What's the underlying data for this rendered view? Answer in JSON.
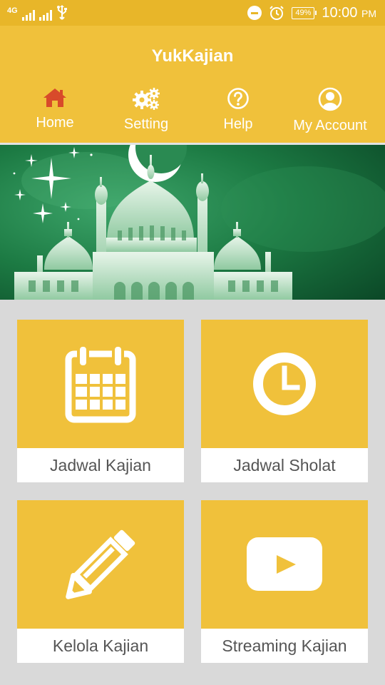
{
  "status_bar": {
    "network": "4G",
    "battery": "49%",
    "time": "10:00",
    "ampm": "PM"
  },
  "app": {
    "title": "YukKajian"
  },
  "nav": {
    "items": [
      {
        "label": "Home",
        "icon": "home-icon",
        "active": true
      },
      {
        "label": "Setting",
        "icon": "gear-icon"
      },
      {
        "label": "Help",
        "icon": "help-icon"
      },
      {
        "label": "My Account",
        "icon": "account-icon"
      }
    ]
  },
  "menu": {
    "tiles": [
      {
        "label": "Jadwal Kajian",
        "icon": "calendar-icon"
      },
      {
        "label": "Jadwal Sholat",
        "icon": "clock-icon"
      },
      {
        "label": "Kelola Kajian",
        "icon": "pencil-icon"
      },
      {
        "label": "Streaming Kajian",
        "icon": "youtube-play-icon"
      }
    ]
  },
  "colors": {
    "header": "#f0c13b",
    "status_bar": "#e8b629",
    "home_icon_active": "#d84a2a",
    "tile_text": "#555555",
    "background": "#d9d9d9"
  }
}
